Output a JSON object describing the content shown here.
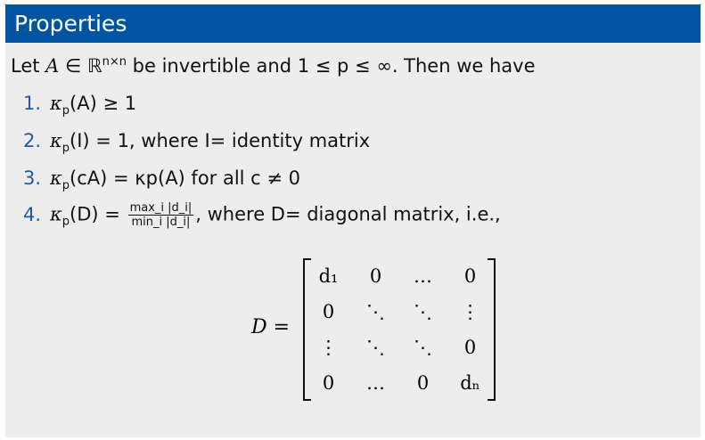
{
  "title": "Properties",
  "intro": {
    "pre": "Let ",
    "A": "A",
    "in": " ∈ ℝ",
    "sup": "n×n",
    "post": " be invertible and 1 ≤ p ≤ ∞. Then we have"
  },
  "items": [
    {
      "num": "1.",
      "text": "κ",
      "sub": "p",
      "rest": "(A) ≥ 1"
    },
    {
      "num": "2.",
      "text": "κ",
      "sub": "p",
      "rest": "(I) = 1, where I= identity matrix"
    },
    {
      "num": "3.",
      "text": "κ",
      "sub": "p",
      "rest": "(cA) = κp(A) for all c ≠ 0"
    },
    {
      "num": "4.",
      "text": "κ",
      "sub": "p",
      "rest": "(D) = ",
      "frac_top": "max_i |d_i|",
      "frac_bot": "min_i |d_i|",
      "after": ", where D= diagonal matrix, i.e.,"
    }
  ],
  "matrix": {
    "label": "D =",
    "cells": [
      "d₁",
      "0",
      "…",
      "0",
      "0",
      "⋱",
      "⋱",
      "⋮",
      "⋮",
      "⋱",
      "⋱",
      "0",
      "0",
      "…",
      "0",
      "dₙ"
    ]
  }
}
